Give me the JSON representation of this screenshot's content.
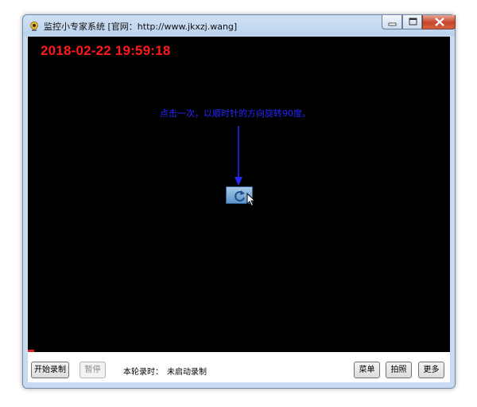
{
  "window": {
    "title": "监控小专家系统 [官网：http://www.jkxzj.wang]"
  },
  "video": {
    "timestamp": "2018-02-22 19:59:18",
    "hint": "点击一次，以顺时针的方向旋转90度。",
    "timestamp_color": "#ff1a1a",
    "hint_color": "#2626ff"
  },
  "controls": {
    "start_record": "开始录制",
    "pause": "暂停",
    "round_label": "本轮录时：",
    "round_status": "未启动录制",
    "menu": "菜单",
    "snapshot": "拍照",
    "more": "更多"
  }
}
